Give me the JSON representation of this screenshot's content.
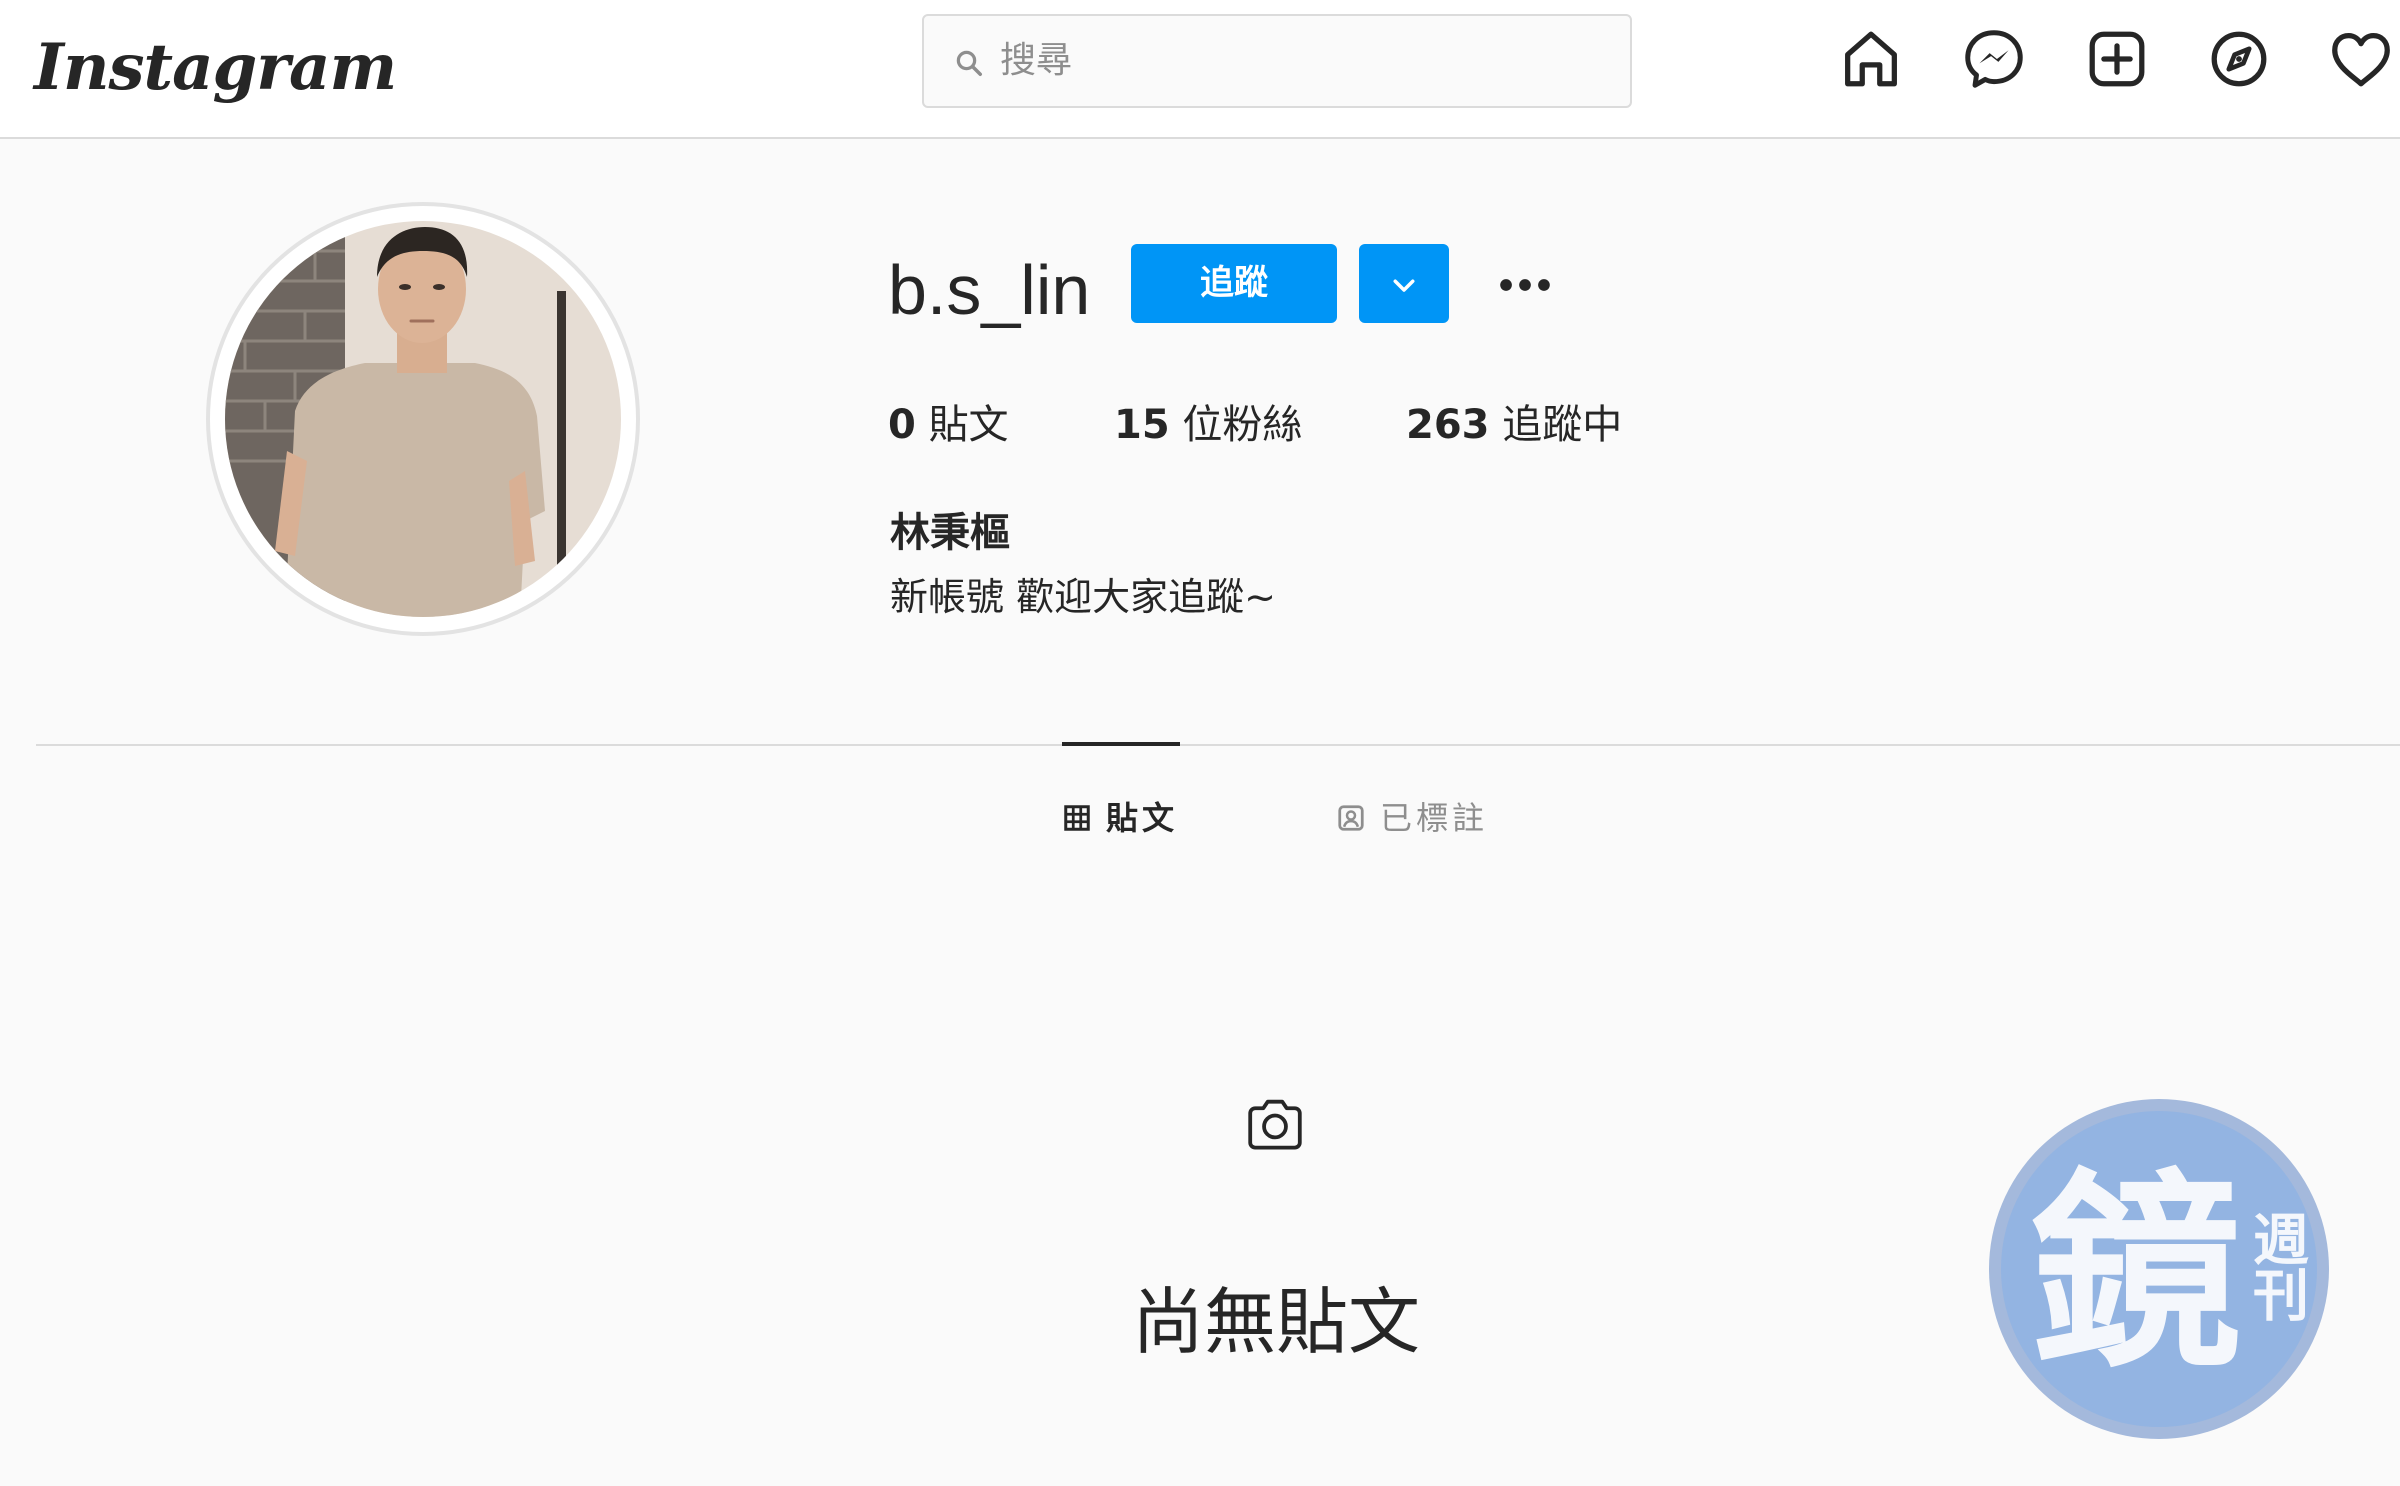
{
  "topbar": {
    "logo_text": "Instagram",
    "search_placeholder": "搜尋",
    "icons": [
      "home-icon",
      "messenger-icon",
      "new-post-icon",
      "explore-icon",
      "activity-heart-icon"
    ]
  },
  "profile": {
    "username": "b.s_lin",
    "follow_label": "追蹤",
    "stats": {
      "posts_count": "0",
      "posts_label": "貼文",
      "followers_count": "15",
      "followers_label": "位粉絲",
      "following_count": "263",
      "following_label": "追蹤中"
    },
    "full_name": "林秉樞",
    "bio": "新帳號 歡迎大家追蹤~"
  },
  "tabs": [
    {
      "label": "貼文",
      "icon": "grid-icon",
      "active": true
    },
    {
      "label": "已標註",
      "icon": "tagged-icon",
      "active": false
    }
  ],
  "empty_state": {
    "icon": "camera-icon",
    "text": "尚無貼文"
  },
  "watermark": {
    "main_char": "鏡",
    "side_chars": "週刊"
  },
  "colors": {
    "accent": "#0095f6",
    "background": "#fafafa",
    "text": "#262626",
    "muted": "#8e8e8e",
    "border": "#dbdbdb"
  }
}
